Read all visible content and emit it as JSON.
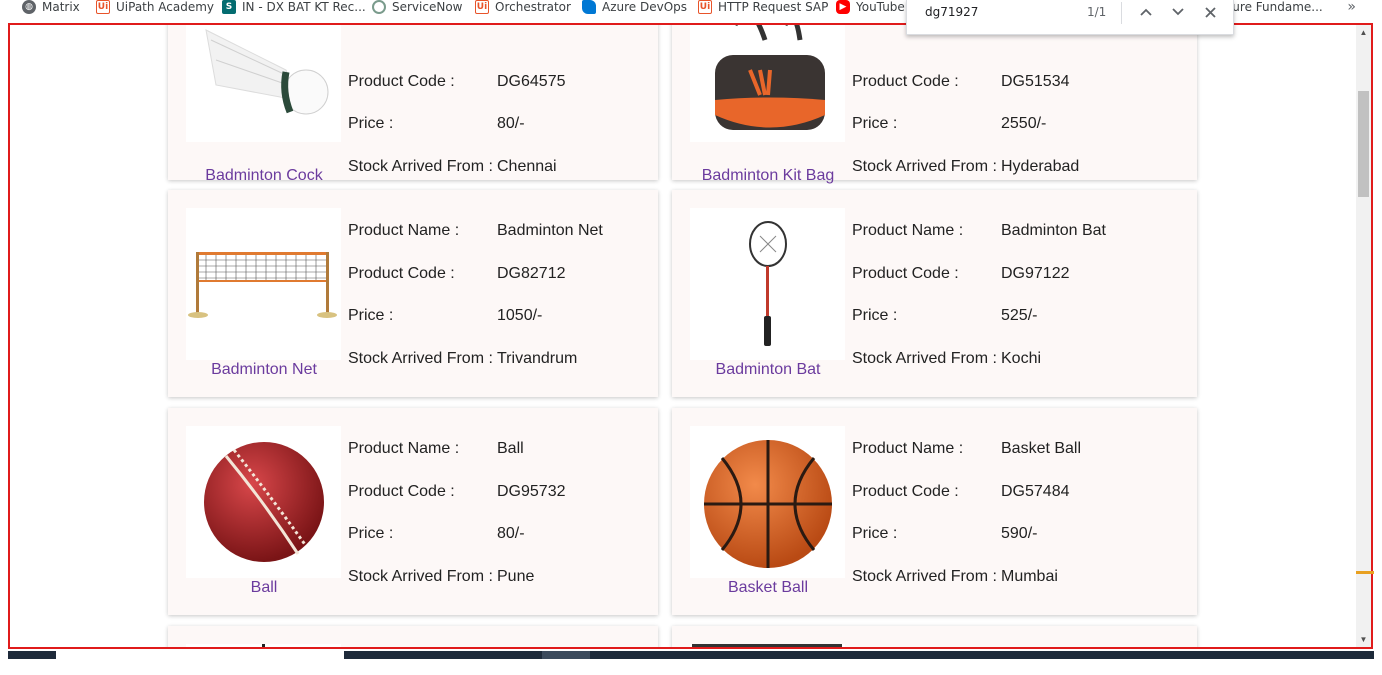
{
  "bookmarks": [
    {
      "label": "Matrix",
      "icon": "globe-icon",
      "kind": "globe"
    },
    {
      "label": "UiPath Academy",
      "icon": "uipath-icon",
      "kind": "ui"
    },
    {
      "label": "IN - DX BAT KT Rec...",
      "icon": "sharepoint-icon",
      "kind": "sp"
    },
    {
      "label": "ServiceNow",
      "icon": "servicenow-icon",
      "kind": "sn"
    },
    {
      "label": "Orchestrator",
      "icon": "uipath-icon",
      "kind": "ui"
    },
    {
      "label": "Azure DevOps",
      "icon": "azure-devops-icon",
      "kind": "az"
    },
    {
      "label": "HTTP Request SAP",
      "icon": "uipath-icon",
      "kind": "ui"
    },
    {
      "label": "YouTube",
      "icon": "youtube-icon",
      "kind": "yt"
    },
    {
      "label": "zure Fundame...",
      "icon": "",
      "kind": "none"
    }
  ],
  "more_label": "»",
  "find": {
    "query": "dg71927",
    "count": "1/1"
  },
  "labels": {
    "name": "Product Name :",
    "code": "Product Code :",
    "price": "Price :",
    "stock": "Stock Arrived From :"
  },
  "products": [
    {
      "caption": "Badminton Cock",
      "name": "",
      "code": "DG64575",
      "price": "80/-",
      "stock": "Chennai",
      "image": "shuttlecock"
    },
    {
      "caption": "Badminton Kit Bag",
      "name": "",
      "code": "DG51534",
      "price": "2550/-",
      "stock": "Hyderabad",
      "image": "kitbag"
    },
    {
      "caption": "Badminton Net",
      "name": "Badminton Net",
      "code": "DG82712",
      "price": "1050/-",
      "stock": "Trivandrum",
      "image": "net"
    },
    {
      "caption": "Badminton Bat",
      "name": "Badminton Bat",
      "code": "DG97122",
      "price": "525/-",
      "stock": "Kochi",
      "image": "racket"
    },
    {
      "caption": "Ball",
      "name": "Ball",
      "code": "DG95732",
      "price": "80/-",
      "stock": "Pune",
      "image": "cricketball"
    },
    {
      "caption": "Basket Ball",
      "name": "Basket Ball",
      "code": "DG57484",
      "price": "590/-",
      "stock": "Mumbai",
      "image": "basketball"
    }
  ],
  "colors": {
    "caption": "#6b3b9e",
    "card_bg": "#fdf8f7",
    "highlight_border": "#e01b1b"
  }
}
